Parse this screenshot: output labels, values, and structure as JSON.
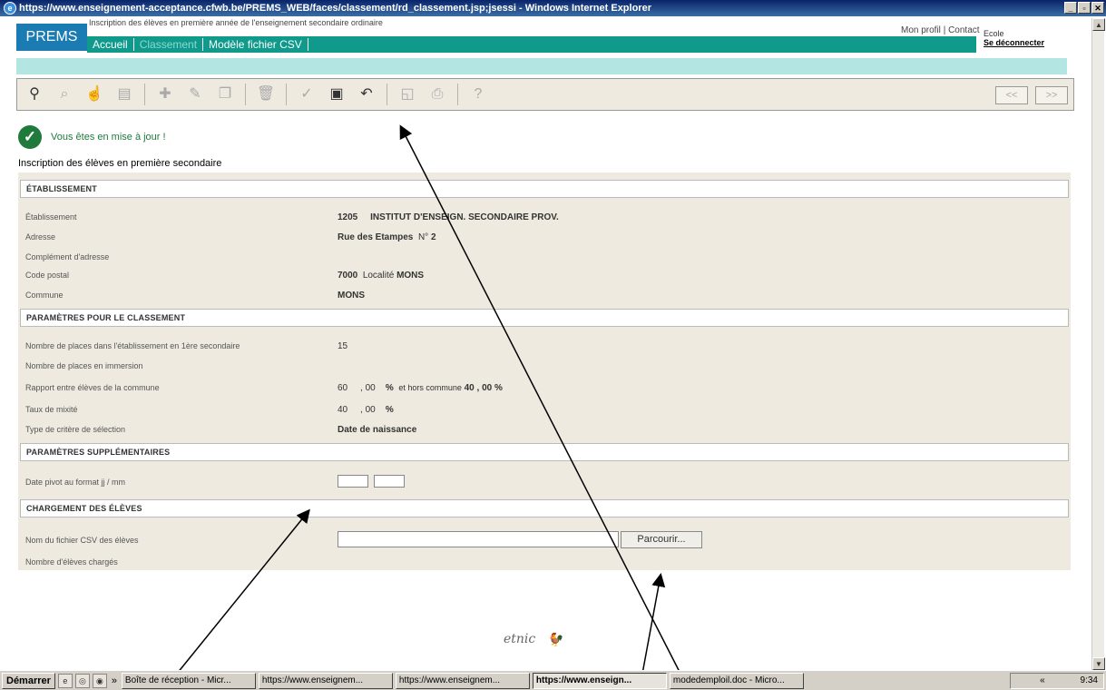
{
  "window": {
    "title": "https://www.enseignement-acceptance.cfwb.be/PREMS_WEB/faces/classement/rd_classement.jsp;jsessi - Windows Internet Explorer",
    "controls": [
      "_",
      "▫",
      "✕"
    ]
  },
  "header": {
    "logo": "PREMS",
    "subtitle": "Inscription des élèves en première année de l'enseignement secondaire ordinaire",
    "nav": [
      "Accueil",
      "Classement",
      "Modèle fichier CSV"
    ],
    "active_nav": "Classement",
    "profile_link": "Mon profil",
    "contact_link": "Contact",
    "links_sep": "|",
    "ecole": "Ecole",
    "logout": "Se déconnecter"
  },
  "toolbar": {
    "icons": [
      "binoculars-icon",
      "magnifier-icon",
      "hand-icon",
      "document-icon",
      "add-icon",
      "edit-icon",
      "copy-icon",
      "delete-icon",
      "validate-icon",
      "save-icon",
      "undo-icon",
      "preview-icon",
      "print-icon",
      "help-icon"
    ],
    "prev": "<<",
    "next": ">>"
  },
  "status": {
    "message": "Vous êtes en mise à jour !",
    "color": "#1f7a3c"
  },
  "page_title": "Inscription des élèves en première secondaire",
  "sections": {
    "etablissement": {
      "title": "ÉTABLISSEMENT",
      "label_etab": "Établissement",
      "etab_code": "1205",
      "etab_name": "INSTITUT D'ENSEIGN. SECONDAIRE PROV.",
      "label_adresse": "Adresse",
      "adresse": "Rue des Etampes",
      "num_label": "N°",
      "num": "2",
      "label_complement": "Complément d'adresse",
      "label_cp": "Code postal",
      "cp": "7000",
      "localite_label": "Localité",
      "localite": "MONS",
      "label_commune": "Commune",
      "commune": "MONS"
    },
    "parametres": {
      "title": "PARAMÈTRES POUR LE CLASSEMENT",
      "label_places": "Nombre de places dans l'établissement en 1ère secondaire",
      "places": "15",
      "label_immersion": "Nombre de places en immersion",
      "label_rapport": "Rapport entre élèves de la commune",
      "rapport_int": "60",
      "rapport_dec": ", 00",
      "pct": "%",
      "hors_label": "et hors commune",
      "hors_int": "40",
      "hors_dec": ", 00",
      "label_mixite": "Taux de mixité",
      "mixite_int": "40",
      "mixite_dec": ", 00",
      "label_critere": "Type de critère de sélection",
      "critere": "Date de naissance"
    },
    "supplementaires": {
      "title": "PARAMÈTRES SUPPLÉMENTAIRES",
      "label_pivot": "Date pivot au format jj / mm"
    },
    "chargement": {
      "title": "CHARGEMENT DES ÉLÈVES",
      "label_fichier": "Nom du fichier CSV des élèves",
      "browse": "Parcourir...",
      "label_charges": "Nombre d'élèves chargés"
    }
  },
  "footer": {
    "logo_text": "etnic"
  },
  "taskbar": {
    "start": "Démarrer",
    "more": "»",
    "tasks": [
      "Boîte de réception - Micr...",
      "https://www.enseignem...",
      "https://www.enseignem...",
      "https://www.enseign...",
      "modedemploil.doc - Micro..."
    ],
    "active_task": 3,
    "tray_more": "«",
    "clock": "9:34"
  }
}
